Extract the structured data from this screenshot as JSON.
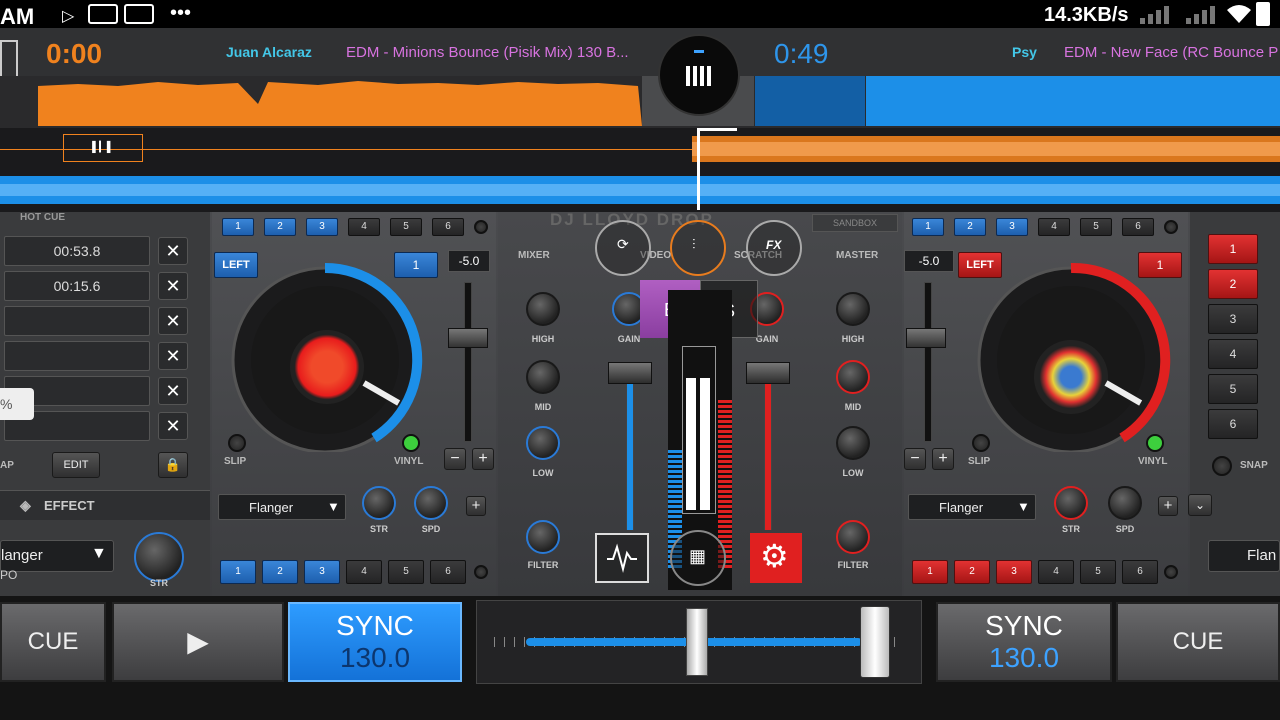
{
  "status": {
    "time": "AM",
    "net_rate": "14.3KB/s"
  },
  "deckA": {
    "elapsed": "0:00",
    "artist": "Juan Alcaraz",
    "title": "EDM - Minions Bounce (Pisik Mix) 130 B...",
    "hot_cue_header": "HOT CUE",
    "cues": [
      "00:53.8",
      "00:15.6",
      "",
      "",
      "",
      ""
    ],
    "edit_label": "EDIT",
    "snap_label": "AP",
    "left_label": "LEFT",
    "deck_number": "1",
    "pitch": "-5.0",
    "slip_label": "SLIP",
    "vinyl_label": "VINYL",
    "effect_panel_label": "EFFECT",
    "effect_select": "Flanger",
    "side_effect_select": "langer",
    "side_effect_sub": "PO",
    "knob_str": "STR",
    "knob_spd": "SPD",
    "pads": [
      "1",
      "2",
      "3",
      "4",
      "5",
      "6"
    ],
    "cue_button": "CUE",
    "play_button": "▶",
    "sync": "SYNC",
    "bpm": "130.0",
    "percent": "%"
  },
  "deckB": {
    "elapsed": "0:49",
    "artist": "Psy",
    "title": "EDM - New Face (RC Bounce P",
    "left_label": "LEFT",
    "deck_number": "1",
    "pitch": "-5.0",
    "slip_label": "SLIP",
    "vinyl_label": "VINYL",
    "snap_label": "SNAP",
    "effect_select": "Flanger",
    "side_effect_select": "Flan",
    "knob_str": "STR",
    "knob_spd": "SPD",
    "pads": [
      "1",
      "2",
      "3",
      "4",
      "5",
      "6"
    ],
    "hot_cues": [
      "1",
      "2",
      "3",
      "4",
      "5",
      "6"
    ],
    "cue_button": "CUE",
    "sync": "SYNC",
    "bpm": "130.0"
  },
  "mixer": {
    "brand": "DJ LLOYD DROP",
    "sandbox": "SANDBOX",
    "mixer_tab": "MIXER",
    "video_tab": "VIDEO",
    "scratch_tab": "SCRATCH",
    "master_tab": "MASTER",
    "fx_label": "FX",
    "b_label": "B",
    "s_label": "S",
    "gain": "GAIN",
    "high": "HIGH",
    "mid": "MID",
    "low": "LOW",
    "filter": "FILTER"
  },
  "colors": {
    "deckA": "#f0821e",
    "deckB": "#1c8fe8",
    "red": "#e02020"
  },
  "icons": [
    "menu-bars-icon",
    "waveform-icon",
    "grid-icon",
    "settings-icon",
    "sync-icon",
    "mixer-sliders-icon",
    "play-icon",
    "lock-icon",
    "chevron-down-icon",
    "plus-icon",
    "minus-icon",
    "close-icon",
    "wifi-icon",
    "signal-icon"
  ]
}
